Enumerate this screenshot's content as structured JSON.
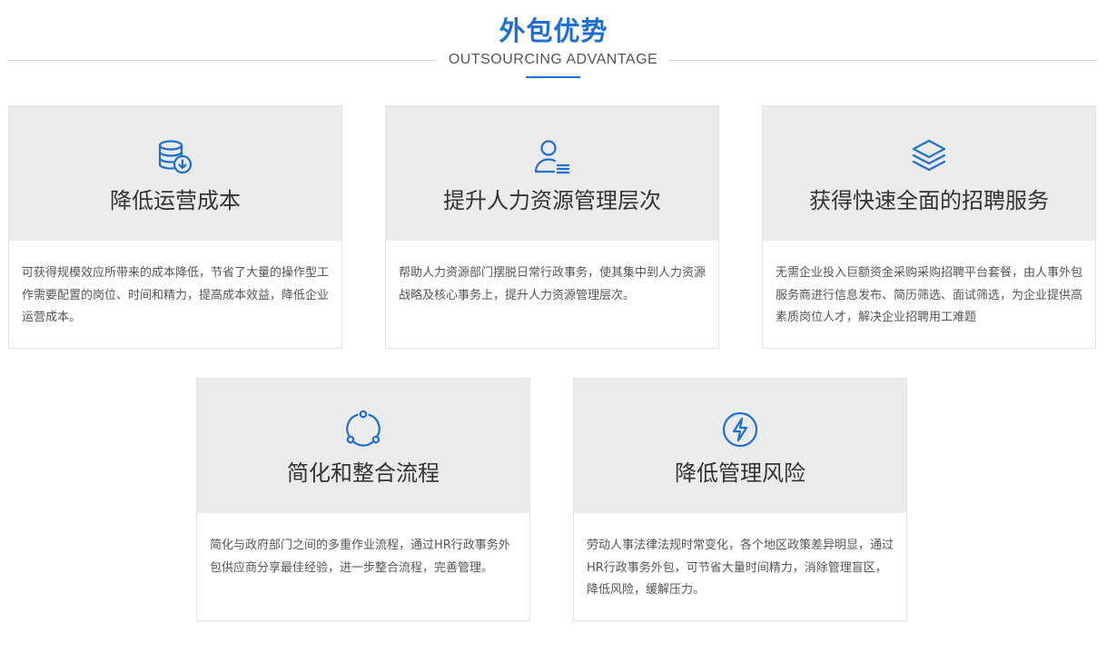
{
  "section": {
    "title": "外包优势",
    "subtitle": "OUTSOURCING ADVANTAGE"
  },
  "colors": {
    "accent": "#1f6fd0",
    "card_head_bg": "#ebebeb"
  },
  "cards": [
    {
      "icon": "database-download-icon",
      "title": "降低运营成本",
      "description": "可获得规模效应所带来的成本降低，节省了大量的操作型工作需要配置的岗位、时间和精力，提高成本效益，降低企业运营成本。"
    },
    {
      "icon": "user-list-icon",
      "title": "提升人力资源管理层次",
      "description": "帮助人力资源部门摆脱日常行政事务，使其集中到人力资源战略及核心事务上，提升人力资源管理层次。"
    },
    {
      "icon": "layers-icon",
      "title": "获得快速全面的招聘服务",
      "description": "无需企业投入巨额资金采购采购招聘平台套餐，由人事外包服务商进行信息发布、简历筛选、面试筛选，为企业提供高素质岗位人才，解决企业招聘用工难题"
    },
    {
      "icon": "circular-flow-icon",
      "title": "简化和整合流程",
      "description": "简化与政府部门之间的多重作业流程，通过HR行政事务外包供应商分享最佳经验，进一步整合流程，完善管理。"
    },
    {
      "icon": "lightning-circle-icon",
      "title": "降低管理风险",
      "description": "劳动人事法律法规时常变化，各个地区政策差异明显，通过HR行政事务外包，可节省大量时间精力，消除管理盲区，降低风险，缓解压力。"
    }
  ]
}
